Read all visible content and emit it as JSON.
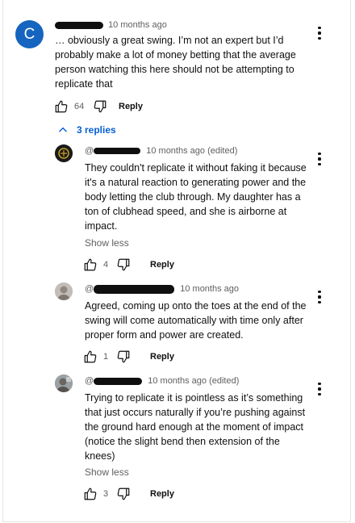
{
  "main_comment": {
    "avatar_letter": "C",
    "avatar_color": "#1565c0",
    "author": "@...",
    "time": "10 months ago",
    "text": "… obviously a great swing. I’m not an expert but I’d probably make a lot of money betting that the average person watching this here should not be attempting to replicate that",
    "likes": "64",
    "reply_label": "Reply"
  },
  "replies_toggle": {
    "label": "3 replies",
    "icon": "chevron-up-icon"
  },
  "replies": [
    {
      "author": "@",
      "time": "10 months ago (edited)",
      "text": "They couldn't replicate it without faking it because it's a natural reaction to generating power and the body letting the club through. My daughter has a ton of clubhead speed, and she is airborne at impact.",
      "show_less": "Show less",
      "likes": "4",
      "reply_label": "Reply"
    },
    {
      "author": "@",
      "time": "10 months ago",
      "text": "Agreed, coming up onto the toes at the end of the swing will come automatically with time only after proper form and power are created.",
      "likes": "1",
      "reply_label": "Reply"
    },
    {
      "author": "@",
      "time": "10 months ago (edited)",
      "text": "Trying to replicate it is pointless as it’s something that just occurs naturally if you’re pushing against the ground hard enough at the moment of impact (notice the slight bend then extension of the knees)",
      "show_less": "Show less",
      "likes": "3",
      "reply_label": "Reply"
    }
  ],
  "colors": {
    "link_blue": "#065fd4",
    "meta_gray": "#606060",
    "text": "#0f0f0f"
  }
}
